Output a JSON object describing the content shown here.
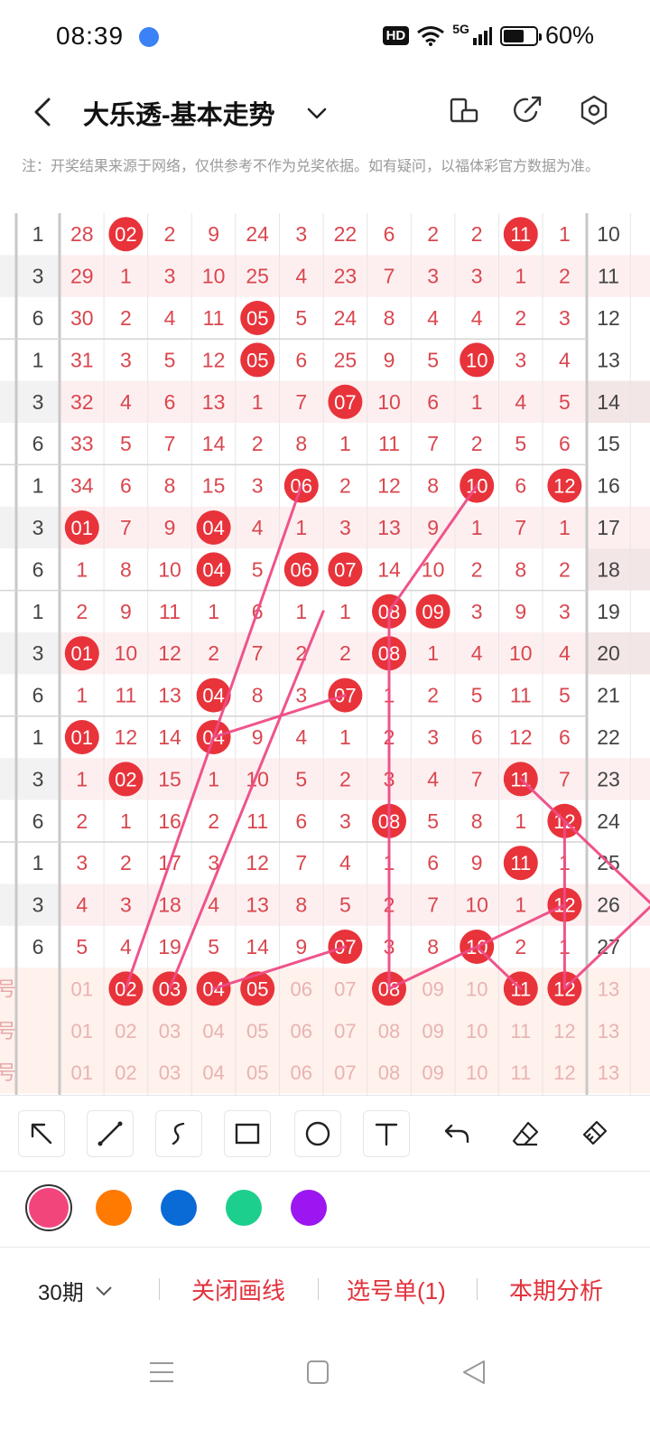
{
  "status_bar": {
    "time": "08:39",
    "hd": "HD",
    "network": "5G",
    "battery": "60%"
  },
  "header": {
    "title": "大乐透-基本走势"
  },
  "note": "注：开奖结果来源于网络，仅供参考不作为兑奖依据。如有疑问，以福体彩官方数据为准。",
  "table": {
    "rows": [
      [
        "1",
        "28",
        "02",
        "2",
        "9",
        "24",
        "3",
        "22",
        "6",
        "2",
        "2",
        "11",
        "1",
        "10"
      ],
      [
        "3",
        "29",
        "1",
        "3",
        "10",
        "25",
        "4",
        "23",
        "7",
        "3",
        "3",
        "1",
        "2",
        "11"
      ],
      [
        "6",
        "30",
        "2",
        "4",
        "11",
        "05",
        "5",
        "24",
        "8",
        "4",
        "4",
        "2",
        "3",
        "12"
      ],
      [
        "1",
        "31",
        "3",
        "5",
        "12",
        "05",
        "6",
        "25",
        "9",
        "5",
        "10",
        "3",
        "4",
        "13"
      ],
      [
        "3",
        "32",
        "4",
        "6",
        "13",
        "1",
        "7",
        "07",
        "10",
        "6",
        "1",
        "4",
        "5",
        "14"
      ],
      [
        "6",
        "33",
        "5",
        "7",
        "14",
        "2",
        "8",
        "1",
        "11",
        "7",
        "2",
        "5",
        "6",
        "15"
      ],
      [
        "1",
        "34",
        "6",
        "8",
        "15",
        "3",
        "06",
        "2",
        "12",
        "8",
        "10",
        "6",
        "12",
        "16"
      ],
      [
        "3",
        "01",
        "7",
        "9",
        "04",
        "4",
        "1",
        "3",
        "13",
        "9",
        "1",
        "7",
        "1",
        "17"
      ],
      [
        "6",
        "1",
        "8",
        "10",
        "04",
        "5",
        "06",
        "07",
        "14",
        "10",
        "2",
        "8",
        "2",
        "18"
      ],
      [
        "1",
        "2",
        "9",
        "11",
        "1",
        "6",
        "1",
        "1",
        "08",
        "09",
        "3",
        "9",
        "3",
        "19"
      ],
      [
        "3",
        "01",
        "10",
        "12",
        "2",
        "7",
        "2",
        "2",
        "08",
        "1",
        "4",
        "10",
        "4",
        "20"
      ],
      [
        "6",
        "1",
        "11",
        "13",
        "04",
        "8",
        "3",
        "07",
        "1",
        "2",
        "5",
        "11",
        "5",
        "21"
      ],
      [
        "1",
        "01",
        "12",
        "14",
        "04",
        "9",
        "4",
        "1",
        "2",
        "3",
        "6",
        "12",
        "6",
        "22"
      ],
      [
        "3",
        "1",
        "02",
        "15",
        "1",
        "10",
        "5",
        "2",
        "3",
        "4",
        "7",
        "11",
        "7",
        "23"
      ],
      [
        "6",
        "2",
        "1",
        "16",
        "2",
        "11",
        "6",
        "3",
        "08",
        "5",
        "8",
        "1",
        "12",
        "24"
      ],
      [
        "1",
        "3",
        "2",
        "17",
        "3",
        "12",
        "7",
        "4",
        "1",
        "6",
        "9",
        "11",
        "1",
        "25"
      ],
      [
        "3",
        "4",
        "3",
        "18",
        "4",
        "13",
        "8",
        "5",
        "2",
        "7",
        "10",
        "1",
        "12",
        "26"
      ],
      [
        "6",
        "5",
        "4",
        "19",
        "5",
        "14",
        "9",
        "07",
        "3",
        "8",
        "10",
        "2",
        "1",
        "27"
      ]
    ],
    "balls": [
      [
        0,
        2
      ],
      [
        0,
        11
      ],
      [
        2,
        5
      ],
      [
        3,
        5
      ],
      [
        3,
        10
      ],
      [
        4,
        7
      ],
      [
        6,
        6
      ],
      [
        6,
        10
      ],
      [
        6,
        12
      ],
      [
        7,
        1
      ],
      [
        7,
        4
      ],
      [
        8,
        4
      ],
      [
        8,
        6
      ],
      [
        8,
        7
      ],
      [
        9,
        8
      ],
      [
        9,
        9
      ],
      [
        10,
        1
      ],
      [
        10,
        8
      ],
      [
        11,
        4
      ],
      [
        11,
        7
      ],
      [
        12,
        1
      ],
      [
        12,
        4
      ],
      [
        13,
        2
      ],
      [
        13,
        11
      ],
      [
        14,
        8
      ],
      [
        14,
        12
      ],
      [
        15,
        11
      ],
      [
        16,
        12
      ],
      [
        17,
        7
      ],
      [
        17,
        10
      ]
    ],
    "footer_rows": [
      {
        "label": "号",
        "cells": [
          "01",
          "02",
          "03",
          "04",
          "05",
          "06",
          "07",
          "08",
          "09",
          "10",
          "11",
          "12",
          "13"
        ],
        "picked": [
          1,
          2,
          3,
          4,
          7,
          10,
          11
        ]
      },
      {
        "label": "号",
        "cells": [
          "01",
          "02",
          "03",
          "04",
          "05",
          "06",
          "07",
          "08",
          "09",
          "10",
          "11",
          "12",
          "13"
        ],
        "picked": []
      },
      {
        "label": "号",
        "cells": [
          "01",
          "02",
          "03",
          "04",
          "05",
          "06",
          "07",
          "08",
          "09",
          "10",
          "11",
          "12",
          "13"
        ],
        "picked": []
      }
    ]
  },
  "toolbar": {
    "tools": [
      "pointer-arrow",
      "line",
      "curve",
      "rectangle",
      "circle",
      "text",
      "undo",
      "eraser",
      "clear"
    ]
  },
  "palette": {
    "colors": [
      "#f2457c",
      "#ff7a00",
      "#0a6ad6",
      "#1ccf8c",
      "#9b16f0"
    ],
    "selected": 0
  },
  "bottom": {
    "period": "30期",
    "close_lines": "关闭画线",
    "selection": "选号单(1)",
    "analysis": "本期分析"
  }
}
